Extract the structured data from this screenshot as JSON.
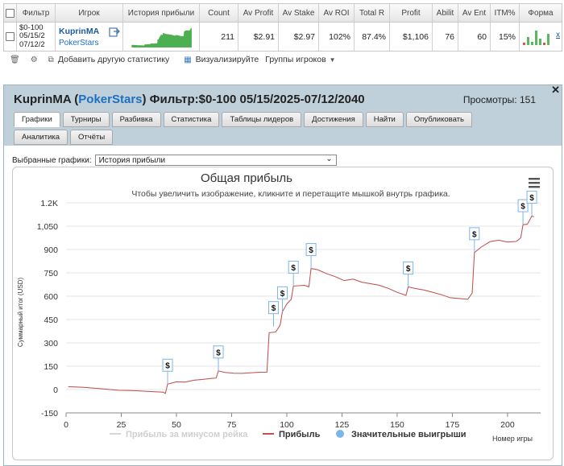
{
  "table": {
    "headers": [
      "Фильтр",
      "Игрок",
      "История прибыли",
      "Count",
      "Av Profit",
      "Av Stake",
      "Av ROI",
      "Total R",
      "Profit",
      "Abilit",
      "Av Ent",
      "ITM%",
      "Форма"
    ],
    "row": {
      "filter_lines": [
        "$0-100",
        "05/15/2",
        "07/12/2"
      ],
      "player_name": "KuprinMA",
      "room": "PokerStars",
      "count": "211",
      "av_profit": "$2.91",
      "av_stake": "$2.97",
      "av_roi": "102%",
      "total_r": "87.4%",
      "profit": "$1,106",
      "ability": "76",
      "av_ent": "60",
      "itm": "15%",
      "close_label": "x"
    }
  },
  "toolbar": {
    "add_label": "Добавить другую статистику",
    "visualize_label": "Визуализируйте",
    "groups_label": "Группы игроков"
  },
  "panel": {
    "title_player": "KuprinMA",
    "title_room": "PokerStars",
    "title_filter": "Фильтр:$0-100 05/15/2025-07/12/2040",
    "views_label": "Просмотры: 151",
    "tabs": [
      "Графики",
      "Турниры",
      "Разбивка",
      "Статистика",
      "Таблицы лидеров",
      "Достижения",
      "Найти",
      "Опубликовать",
      "Аналитика",
      "Отчёты"
    ],
    "select_label": "Выбранные графики:",
    "select_value": "История прибыли"
  },
  "chart_data": {
    "type": "line",
    "title": "Общая прибыль",
    "subtitle": "Чтобы увеличить изображение, кликните и перетащите мышкой внутрь графика.",
    "ylabel": "Суммарный итог (USD)",
    "xlabel": "Номер игры",
    "xlim": [
      0,
      215
    ],
    "ylim": [
      -150,
      1200
    ],
    "x_ticks": [
      "0",
      "25",
      "50",
      "75",
      "100",
      "125",
      "150",
      "175",
      "200"
    ],
    "y_ticks": [
      "1.2K",
      "1,050",
      "900",
      "750",
      "600",
      "450",
      "300",
      "150",
      "0",
      "-150"
    ],
    "legend": [
      "Прибыль за минусом рейка",
      "Прибыль",
      "Значительные выигрыши"
    ],
    "series": [
      {
        "name": "Прибыль",
        "color": "#c0504d",
        "points": [
          [
            1,
            18
          ],
          [
            4,
            17
          ],
          [
            8,
            14
          ],
          [
            12,
            10
          ],
          [
            16,
            5
          ],
          [
            20,
            0
          ],
          [
            24,
            -5
          ],
          [
            28,
            -6
          ],
          [
            32,
            -8
          ],
          [
            36,
            -11
          ],
          [
            40,
            -14
          ],
          [
            44,
            -17
          ],
          [
            45,
            -25
          ],
          [
            46,
            35
          ],
          [
            50,
            50
          ],
          [
            54,
            48
          ],
          [
            58,
            60
          ],
          [
            62,
            65
          ],
          [
            66,
            72
          ],
          [
            68,
            74
          ],
          [
            69,
            120
          ],
          [
            72,
            110
          ],
          [
            76,
            105
          ],
          [
            80,
            104
          ],
          [
            84,
            108
          ],
          [
            88,
            111
          ],
          [
            91,
            112
          ],
          [
            92,
            365
          ],
          [
            95,
            370
          ],
          [
            97,
            415
          ],
          [
            98,
            500
          ],
          [
            100,
            550
          ],
          [
            102,
            580
          ],
          [
            103,
            665
          ],
          [
            108,
            670
          ],
          [
            110,
            660
          ],
          [
            111,
            778
          ],
          [
            114,
            770
          ],
          [
            118,
            745
          ],
          [
            122,
            725
          ],
          [
            126,
            700
          ],
          [
            130,
            710
          ],
          [
            134,
            690
          ],
          [
            138,
            680
          ],
          [
            142,
            670
          ],
          [
            146,
            650
          ],
          [
            150,
            625
          ],
          [
            154,
            605
          ],
          [
            155,
            660
          ],
          [
            158,
            650
          ],
          [
            162,
            640
          ],
          [
            166,
            625
          ],
          [
            170,
            610
          ],
          [
            174,
            590
          ],
          [
            178,
            585
          ],
          [
            182,
            580
          ],
          [
            184,
            620
          ],
          [
            185,
            880
          ],
          [
            188,
            915
          ],
          [
            192,
            950
          ],
          [
            196,
            960
          ],
          [
            200,
            948
          ],
          [
            204,
            952
          ],
          [
            206,
            975
          ],
          [
            207,
            1060
          ],
          [
            209,
            1062
          ],
          [
            211,
            1115
          ],
          [
            212,
            1110
          ]
        ]
      }
    ],
    "big_wins": [
      [
        46,
        35
      ],
      [
        69,
        120
      ],
      [
        94,
        405
      ],
      [
        98,
        500
      ],
      [
        103,
        665
      ],
      [
        111,
        778
      ],
      [
        155,
        660
      ],
      [
        185,
        880
      ],
      [
        207,
        1060
      ],
      [
        211,
        1115
      ]
    ],
    "colors": {
      "net_line": "#d6d6d6",
      "profit_line": "#c0504d",
      "big_wins": "#7cb5ec"
    }
  },
  "icons": {
    "menu": "hamburger-menu-icon",
    "dollar": "dollar-flag-icon"
  }
}
